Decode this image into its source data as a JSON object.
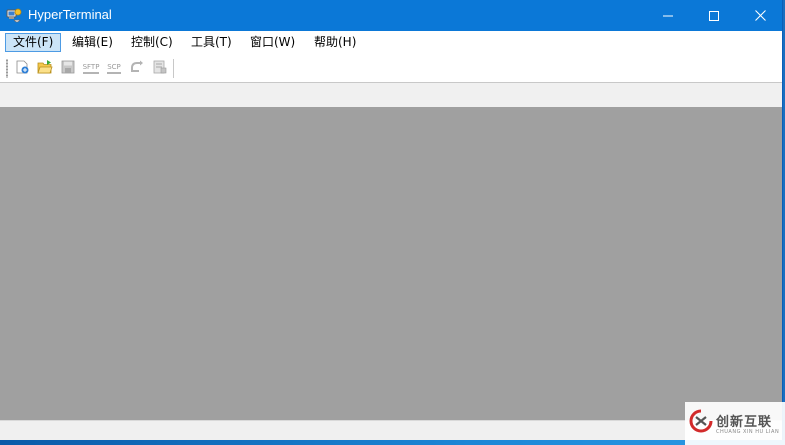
{
  "window": {
    "title": "HyperTerminal",
    "accent_color": "#0b78d7",
    "mdi_background": "#a0a0a0"
  },
  "title_bar": {
    "icon": "hyperterminal-app-icon",
    "controls": [
      {
        "name": "minimize",
        "icon": "minimize-icon"
      },
      {
        "name": "maximize",
        "icon": "maximize-icon"
      },
      {
        "name": "close",
        "icon": "close-icon"
      }
    ]
  },
  "menu": {
    "items": [
      {
        "label": "文件(F)",
        "active": true
      },
      {
        "label": "编辑(E)",
        "active": false
      },
      {
        "label": "控制(C)",
        "active": false
      },
      {
        "label": "工具(T)",
        "active": false
      },
      {
        "label": "窗口(W)",
        "active": false
      },
      {
        "label": "帮助(H)",
        "active": false
      }
    ]
  },
  "toolbar": {
    "buttons": [
      {
        "name": "new-connection",
        "icon": "new-connection-icon",
        "enabled": true
      },
      {
        "name": "open",
        "icon": "open-folder-icon",
        "enabled": true
      },
      {
        "name": "save",
        "icon": "save-icon",
        "enabled": false
      },
      {
        "name": "sftp",
        "icon": "sftp-icon",
        "label": "SFTP",
        "enabled": false
      },
      {
        "name": "scp",
        "icon": "scp-icon",
        "label": "SCP",
        "enabled": false
      },
      {
        "name": "reconnect",
        "icon": "reconnect-icon",
        "enabled": false
      },
      {
        "name": "properties",
        "icon": "properties-icon",
        "enabled": false
      }
    ]
  },
  "watermark": {
    "title": "创新互联",
    "subtitle": "CHUANG XIN HU LIAN",
    "icon": "chuangxin-logo-icon"
  }
}
